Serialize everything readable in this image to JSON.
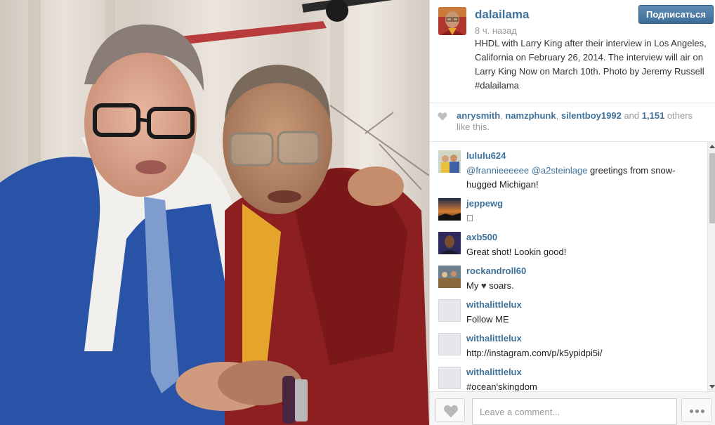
{
  "post": {
    "username": "dalailama",
    "time_ago": "8 ч. назад",
    "follow_label": "Подписаться",
    "caption": "HHDL with Larry King after their interview in Los Angeles, California on February 26, 2014. The interview will air on Larry King Now on March 10th. Photo by Jeremy Russell #dalailama"
  },
  "likes": {
    "user1": "anrysmith",
    "sep1": ", ",
    "user2": "namzphunk",
    "sep2": ", ",
    "user3": "silentboy1992",
    "and": " and ",
    "count": "1,151",
    "suffix": " others like this."
  },
  "comments": [
    {
      "user": "lululu624",
      "mention1": "@frannieeeeee",
      "mention2": "@a2steinlage",
      "rest": " greetings from snow-hugged Michigan!"
    },
    {
      "user": "jeppewg",
      "text": "󾌵"
    },
    {
      "user": "axb500",
      "text": "Great shot! Lookin good!"
    },
    {
      "user": "rockandroll60",
      "text_before": "My ",
      "text_after": " soars."
    },
    {
      "user": "withalittlelux",
      "text": "Follow ME"
    },
    {
      "user": "withalittlelux",
      "text": "http://instagram.com/p/k5ypidpi5i/"
    },
    {
      "user": "withalittlelux",
      "text": "#ocean'skingdom"
    }
  ],
  "footer": {
    "comment_placeholder": "Leave a comment..."
  },
  "colors": {
    "link": "#3f729b",
    "follow_button": "#4a7ca5",
    "muted_text": "#999999"
  },
  "icons": {
    "heart": "heart-icon",
    "more": "more-dots-icon"
  }
}
